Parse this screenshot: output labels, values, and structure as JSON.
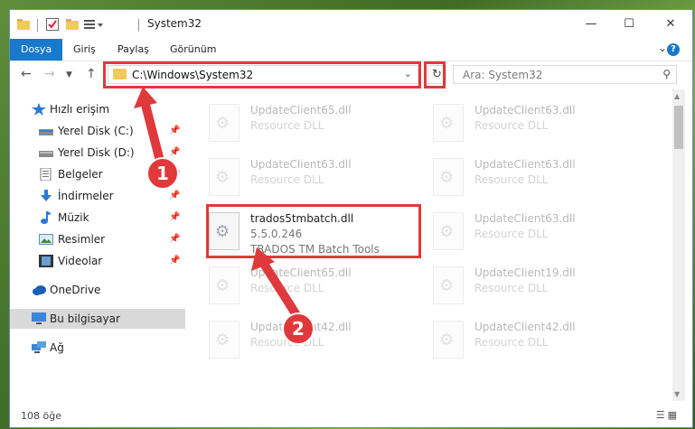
{
  "window": {
    "title": "System32"
  },
  "ribbon": {
    "tabs": [
      "Dosya",
      "Giriş",
      "Paylaş",
      "Görünüm"
    ],
    "help": "?"
  },
  "address": {
    "path": "C:\\Windows\\System32",
    "search_placeholder": "Ara: System32"
  },
  "sidebar": {
    "items": [
      {
        "label": "Hızlı erişim",
        "icon": "star-icon"
      },
      {
        "label": "Yerel Disk (C:)",
        "icon": "drive-icon",
        "pinned": true
      },
      {
        "label": "Yerel Disk (D:)",
        "icon": "drive-icon",
        "pinned": true
      },
      {
        "label": "Belgeler",
        "icon": "documents-icon",
        "pinned": true
      },
      {
        "label": "İndirmeler",
        "icon": "download-icon",
        "pinned": true
      },
      {
        "label": "Müzik",
        "icon": "music-icon",
        "pinned": true
      },
      {
        "label": "Resimler",
        "icon": "pictures-icon",
        "pinned": true
      },
      {
        "label": "Videolar",
        "icon": "video-icon",
        "pinned": true
      },
      {
        "label": "OneDrive",
        "icon": "cloud-icon"
      },
      {
        "label": "Bu bilgisayar",
        "icon": "computer-icon",
        "selected": true
      },
      {
        "label": "Ağ",
        "icon": "network-icon"
      }
    ]
  },
  "files": {
    "left": [
      {
        "name": "UpdateClient65.dll",
        "desc": "Resource DLL"
      },
      {
        "name": "UpdateClient63.dll",
        "desc": "Resource DLL"
      },
      {
        "name": "trados5tmbatch.dll",
        "desc": "5.5.0.246",
        "desc2": "TRADOS TM Batch Tools"
      },
      {
        "name": "UpdateClient65.dll",
        "desc": "Resource DLL"
      },
      {
        "name": "UpdateClient42.dll",
        "desc": "Resource DLL"
      }
    ],
    "right": [
      {
        "name": "UpdateClient63.dll",
        "desc": "Resource DLL"
      },
      {
        "name": "UpdateClient63.dll",
        "desc": "Resource DLL"
      },
      {
        "name": "UpdateClient63.dll",
        "desc": "Resource DLL"
      },
      {
        "name": "UpdateClient19.dll",
        "desc": "Resource DLL"
      },
      {
        "name": "UpdateClient42.dll",
        "desc": "Resource DLL"
      }
    ]
  },
  "status": {
    "count": "108 öğe"
  },
  "annotations": {
    "step1": "1",
    "step2": "2",
    "color": "#e0393c"
  }
}
